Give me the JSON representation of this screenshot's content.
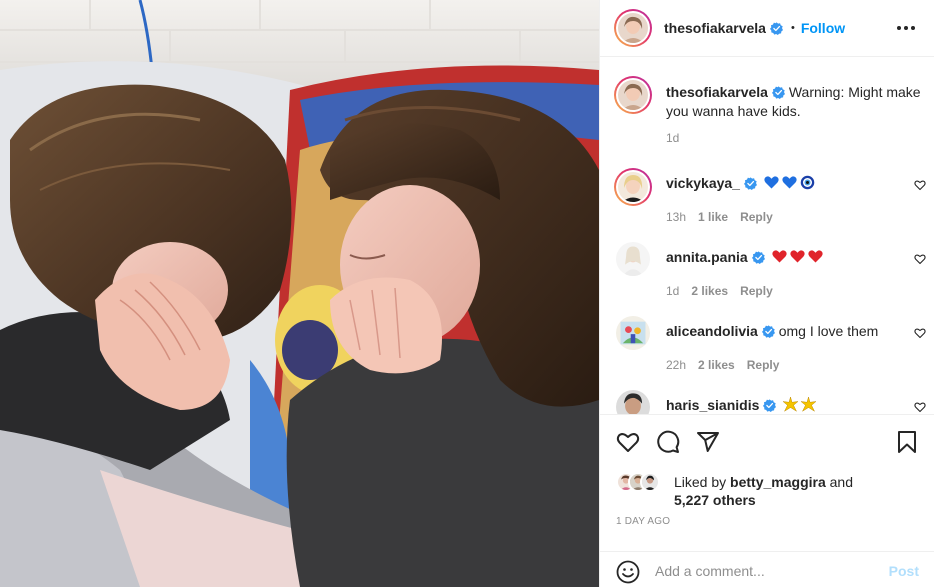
{
  "header": {
    "username": "thesofiakarvela",
    "separator": "•",
    "follow_label": "Follow",
    "more_icon": "more-horizontal-icon"
  },
  "caption": {
    "username": "thesofiakarvela",
    "text": "Warning: Might make you wanna have kids.",
    "time": "1d"
  },
  "comments": [
    {
      "username": "vickykaya_",
      "emojis": [
        "blue-heart",
        "blue-heart",
        "nazar-amulet"
      ],
      "time": "13h",
      "likes": "1 like",
      "reply": "Reply"
    },
    {
      "username": "annita.pania",
      "emojis": [
        "red-heart",
        "red-heart",
        "red-heart"
      ],
      "time": "1d",
      "likes": "2 likes",
      "reply": "Reply"
    },
    {
      "username": "aliceandolivia",
      "text": "omg I love them",
      "time": "22h",
      "likes": "2 likes",
      "reply": "Reply"
    },
    {
      "username": "haris_sianidis",
      "emojis": [
        "sparkle-star",
        "sparkle-star"
      ]
    }
  ],
  "actions": {
    "like_icon": "heart-icon",
    "comment_icon": "comment-icon",
    "share_icon": "share-icon",
    "save_icon": "bookmark-icon"
  },
  "likes": {
    "prefix": "Liked by",
    "user": "betty_maggira",
    "and": "and",
    "others": "5,227 others"
  },
  "posted": "1 DAY AGO",
  "add_comment": {
    "placeholder": "Add a comment...",
    "post_label": "Post",
    "emoji_icon": "smiley-icon"
  },
  "colors": {
    "accent": "#0095f6",
    "verified": "#3897f0",
    "muted": "#8e8e8e",
    "post_disabled": "#b2dffc"
  }
}
